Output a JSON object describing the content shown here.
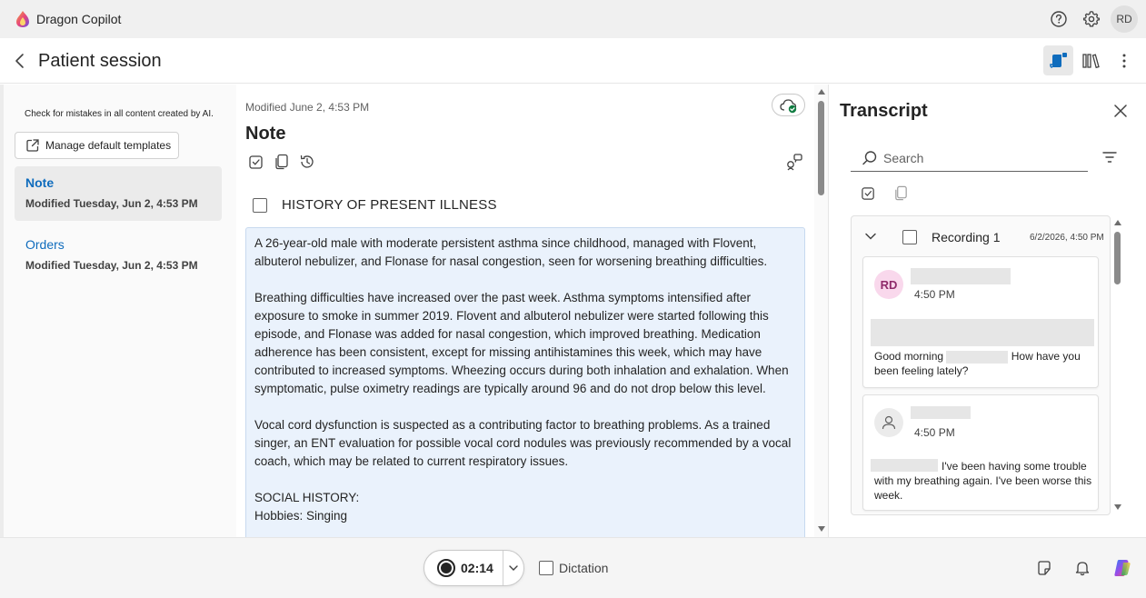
{
  "app": {
    "title": "Dragon Copilot",
    "avatar_initials": "RD",
    "brand_colors": {
      "accent": "#0f6cbd",
      "recording_avatar": "#f9d8ec"
    }
  },
  "header": {
    "title": "Patient session"
  },
  "sidebar": {
    "ai_disclaimer": "Check for mistakes in all content created by AI.",
    "manage_templates_label": "Manage default templates",
    "items": [
      {
        "title": "Note",
        "subtitle": "Modified Tuesday, Jun 2, 4:53 PM",
        "active": true
      },
      {
        "title": "Orders",
        "subtitle": "Modified Tuesday, Jun 2, 4:53 PM",
        "active": false
      }
    ]
  },
  "note": {
    "modified": "Modified June 2, 4:53 PM",
    "title": "Note",
    "section_heading": "HISTORY OF PRESENT ILLNESS",
    "paragraphs": [
      "A 26-year-old male with moderate persistent asthma since childhood, managed with Flovent, albuterol nebulizer, and Flonase for nasal congestion, seen for worsening breathing difficulties.",
      "Breathing difficulties have increased over the past week. Asthma symptoms intensified after exposure to smoke in summer 2019. Flovent and albuterol nebulizer were started following this episode, and Flonase was added for nasal congestion, which improved breathing. Medication adherence has been consistent, except for missing antihistamines this week, which may have contributed to increased symptoms. Wheezing occurs during both inhalation and exhalation. When symptomatic, pulse oximetry readings are typically around 96 and do not drop below this level.",
      "Vocal cord dysfunction is suspected as a contributing factor to breathing problems. As a trained singer, an ENT evaluation for possible vocal cord nodules was previously recommended by a vocal coach, which may be related to current respiratory issues.",
      "SOCIAL HISTORY:\nHobbies: Singing"
    ]
  },
  "transcript": {
    "title": "Transcript",
    "search_placeholder": "Search",
    "recording": {
      "name": "Recording 1",
      "date": "6/2/2026, 4:50 PM"
    },
    "messages": [
      {
        "avatar": "RD",
        "time": "4:50 PM",
        "text_visible": "Good morning",
        "text_visible_2": "How have you been feeling lately?"
      },
      {
        "avatar": "patient",
        "time": "4:50 PM",
        "text_visible": "I've been having some trouble with my breathing again. I've been worse this week."
      }
    ]
  },
  "footer": {
    "timer": "02:14",
    "dictation_label": "Dictation"
  }
}
